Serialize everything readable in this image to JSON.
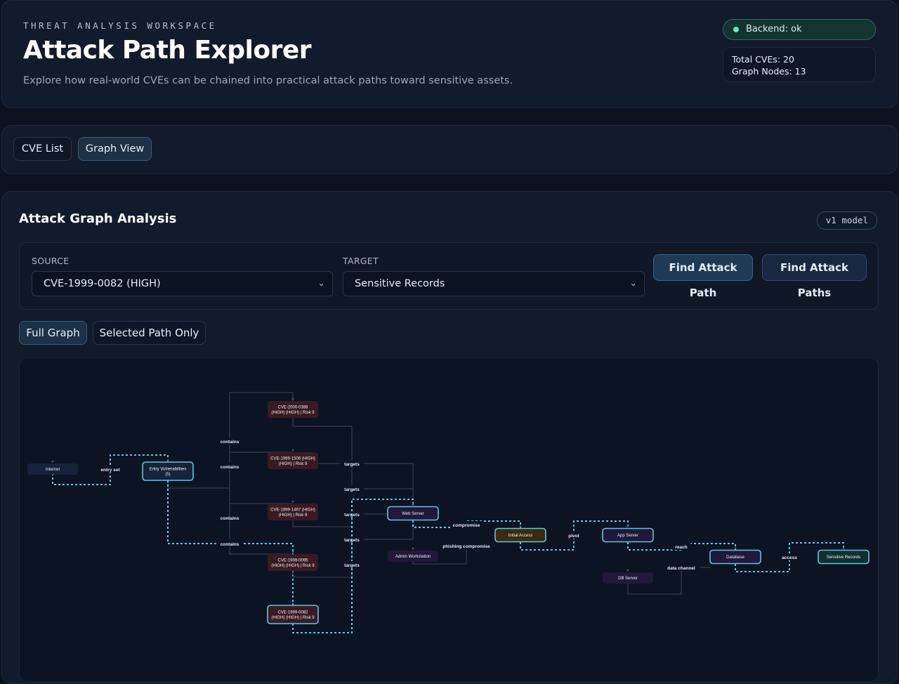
{
  "header": {
    "eyebrow": "THREAT ANALYSIS WORKSPACE",
    "title": "Attack Path Explorer",
    "subtitle": "Explore how real-world CVEs can be chained into practical attack paths toward sensitive assets.",
    "backend_status": "Backend: ok",
    "stats": {
      "total_cves": "Total CVEs: 20",
      "graph_nodes": "Graph Nodes: 13"
    }
  },
  "tabs": {
    "cve_list": "CVE List",
    "graph_view": "Graph View",
    "active": "graph_view"
  },
  "analysis": {
    "title": "Attack Graph Analysis",
    "model_badge": "v1 model",
    "source_label": "SOURCE",
    "source_value": "CVE-1999-0082 (HIGH)",
    "target_label": "TARGET",
    "target_value": "Sensitive Records",
    "find_path_label": "Find Attack Path",
    "find_paths_label": "Find Attack Paths",
    "view_full_label": "Full Graph",
    "view_selected_label": "Selected Path Only",
    "active_view": "full"
  },
  "graph": {
    "colors": {
      "entry": "#16233a",
      "cve": "#3a1a22",
      "asset": "#21183a",
      "access": "#3a2a10",
      "target": "#10302e",
      "highlight": "#5fc6e6"
    },
    "nodes": [
      {
        "id": "internet",
        "lines": [
          "Internet"
        ],
        "kind": "entry"
      },
      {
        "id": "entry",
        "lines": [
          "Entry Vulnerabilities",
          "(5)"
        ],
        "kind": "entry",
        "highlight": true
      },
      {
        "id": "c0388",
        "lines": [
          "CVE-2000-0388",
          "(HIGH) (HIGH) | Risk 9"
        ],
        "kind": "cve"
      },
      {
        "id": "c1506",
        "lines": [
          "CVE-1999-1506 (HIGH)",
          "(HIGH) | Risk 9"
        ],
        "kind": "cve"
      },
      {
        "id": "c1467",
        "lines": [
          "CVE-1999-1467 (HIGH)",
          "(HIGH) | Risk 9"
        ],
        "kind": "cve"
      },
      {
        "id": "c0095",
        "lines": [
          "CVE-1999-0095",
          "(HIGH) (HIGH) | Risk 9"
        ],
        "kind": "cve"
      },
      {
        "id": "c0082",
        "lines": [
          "CVE-1999-0082",
          "(HIGH) (HIGH) | Risk 9"
        ],
        "kind": "cve",
        "highlight": true
      },
      {
        "id": "web",
        "lines": [
          "Web Server"
        ],
        "kind": "asset",
        "highlight": true
      },
      {
        "id": "admin",
        "lines": [
          "Admin Workstation"
        ],
        "kind": "asset"
      },
      {
        "id": "initial",
        "lines": [
          "Initial Access"
        ],
        "kind": "access",
        "highlight": true
      },
      {
        "id": "app",
        "lines": [
          "App Server"
        ],
        "kind": "asset",
        "highlight": true
      },
      {
        "id": "db",
        "lines": [
          "DB Server"
        ],
        "kind": "asset"
      },
      {
        "id": "database",
        "lines": [
          "Database"
        ],
        "kind": "asset",
        "highlight": true
      },
      {
        "id": "sensitive",
        "lines": [
          "Sensitive Records"
        ],
        "kind": "target",
        "highlight": true
      }
    ],
    "edges": [
      {
        "from": "internet",
        "to": "entry",
        "label": "entry set",
        "highlight": true
      },
      {
        "from": "entry",
        "to": "c0388",
        "label": "contains"
      },
      {
        "from": "entry",
        "to": "c1506",
        "label": "contains"
      },
      {
        "from": "entry",
        "to": "c1467",
        "label": "contains"
      },
      {
        "from": "entry",
        "to": "c0095",
        "label": "contains"
      },
      {
        "from": "entry",
        "to": "c0082",
        "label": "contains",
        "highlight": true
      },
      {
        "from": "c0388",
        "to": "web",
        "label": "targets"
      },
      {
        "from": "c1506",
        "to": "web",
        "label": "targets"
      },
      {
        "from": "c1467",
        "to": "web",
        "label": "targets"
      },
      {
        "from": "c0095",
        "to": "web",
        "label": "targets"
      },
      {
        "from": "c0082",
        "to": "web",
        "label": "targets",
        "highlight": true
      },
      {
        "from": "web",
        "to": "initial",
        "label": "compromise",
        "highlight": true
      },
      {
        "from": "admin",
        "to": "initial",
        "label": "phishing compromise"
      },
      {
        "from": "initial",
        "to": "app",
        "label": "pivot",
        "highlight": true
      },
      {
        "from": "app",
        "to": "database",
        "label": "reach",
        "highlight": true
      },
      {
        "from": "db",
        "to": "database",
        "label": "data channel"
      },
      {
        "from": "database",
        "to": "sensitive",
        "label": "access",
        "highlight": true
      }
    ]
  }
}
